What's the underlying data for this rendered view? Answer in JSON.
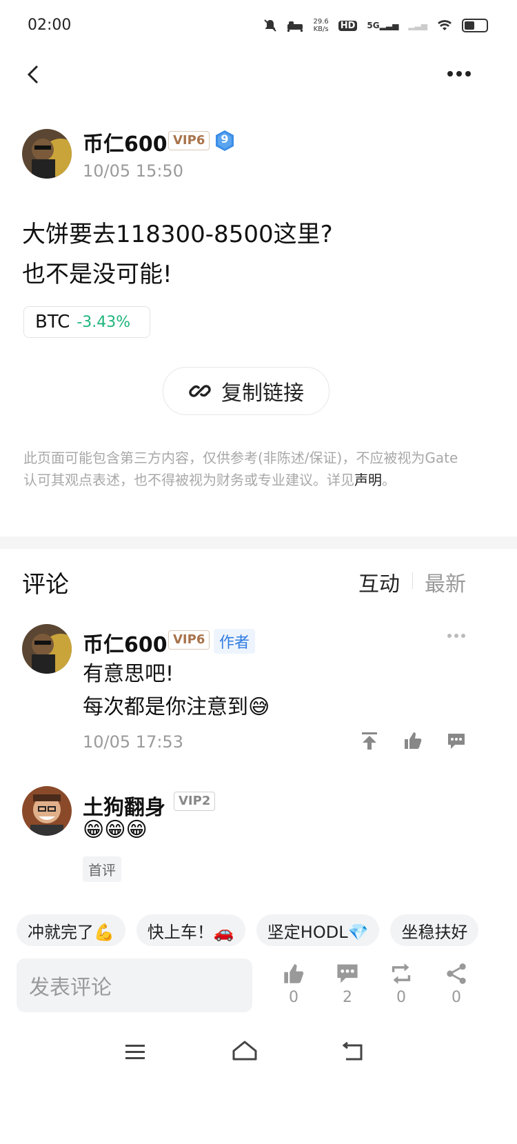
{
  "status_bar": {
    "time": "02:00",
    "net_speed_value": "29.6",
    "net_speed_unit": "KB/s",
    "hd": "HD",
    "hd_sub": "1",
    "five_g": "5G"
  },
  "post": {
    "author": "币仁600",
    "vip": "VIP6",
    "level_badge": "9",
    "time": "10/05 15:50",
    "content_line1": "大饼要去118300-8500这里?",
    "content_line2": "也不是没可能!",
    "tag_symbol": "BTC",
    "tag_change": "-3.43%",
    "copy_link": "复制链接",
    "disclaimer": "此页面可能包含第三方内容，仅供参考(非陈述/保证)，不应被视为Gate认可其观点表述，也不得被视为财务或专业建议。详见",
    "disclaimer_link": "声明",
    "disclaimer_end": "。"
  },
  "comments_section": {
    "title": "评论",
    "tab_interactive": "互动",
    "tab_latest": "最新"
  },
  "comments": [
    {
      "author": "币仁600",
      "vip": "VIP6",
      "badge": "作者",
      "line1": "有意思吧!",
      "line2": "每次都是你注意到😅",
      "time": "10/05 17:53"
    },
    {
      "author": "土狗翻身",
      "vip": "VIP2",
      "line1": "😁😁😁",
      "badge": "首评"
    }
  ],
  "quick_replies": [
    "冲就完了💪",
    "快上车！🚗",
    "坚定HODL💎",
    "坐稳扶好"
  ],
  "bottom_bar": {
    "placeholder": "发表评论",
    "likes": "0",
    "comments": "2",
    "reposts": "0",
    "shares": "0"
  },
  "colors": {
    "positive": "#1fb57c",
    "vip_text": "#a8734b",
    "author_badge": "#2f7de1",
    "level_badge": "#3b8de6"
  }
}
